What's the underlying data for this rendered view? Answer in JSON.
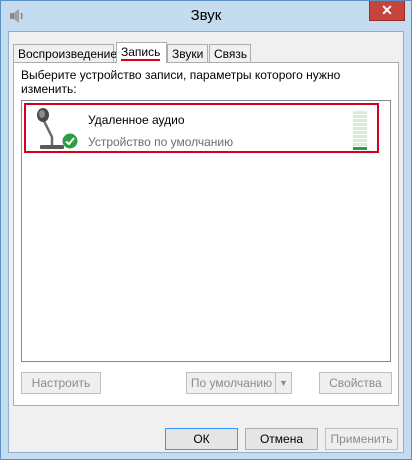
{
  "window": {
    "title": "Звук",
    "close_glyph": "✕",
    "icon": "speaker-icon"
  },
  "tabs": [
    {
      "label": "Воспроизведение",
      "active": false
    },
    {
      "label": "Запись",
      "active": true
    },
    {
      "label": "Звуки",
      "active": false
    },
    {
      "label": "Связь",
      "active": false
    }
  ],
  "panel": {
    "instruction": "Выберите устройство записи, параметры которого нужно изменить:"
  },
  "devices": [
    {
      "name": "Удаленное аудио",
      "status": "Устройство по умолчанию",
      "icon": "microphone-icon",
      "badge": "default-check-icon",
      "level_segments": 10,
      "level_active": 1
    }
  ],
  "panel_buttons": {
    "configure": "Настроить",
    "set_default": "По умолчанию",
    "properties": "Свойства",
    "dropdown_glyph": "▼"
  },
  "dialog_buttons": {
    "ok": "ОК",
    "cancel": "Отмена",
    "apply": "Применить"
  },
  "colors": {
    "accent_red": "#d4001c",
    "check_green": "#2e9e43",
    "title_bar": "#c4dbf0",
    "close_red": "#c7443c"
  }
}
